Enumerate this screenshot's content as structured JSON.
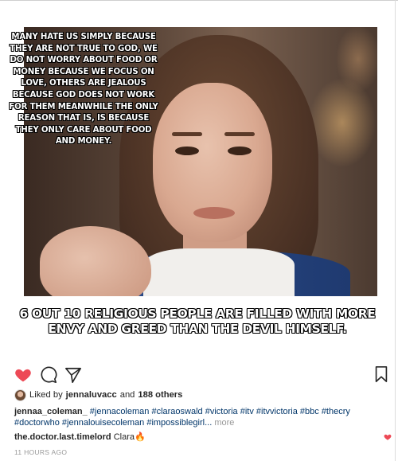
{
  "meme": {
    "top_text": "MANY HATE US SIMPLY BECAUSE THEY ARE NOT TRUE TO GOD, WE DO NOT WORRY ABOUT FOOD OR MONEY BECAUSE WE FOCUS ON LOVE, OTHERS ARE JEALOUS BECAUSE GOD DOES NOT WORK FOR THEM MEANWHILE THE ONLY REASON THAT IS, IS BECAUSE THEY ONLY CARE ABOUT FOOD AND MONEY.",
    "bottom_text": "6 OUT 10 RELIGIOUS PEOPLE ARE FILLED WITH MORE ENVY AND GREED THAN THE DEVIL HIMSELF."
  },
  "actions": {
    "like_icon": "heart-icon",
    "comment_icon": "comment-icon",
    "share_icon": "paper-plane-icon",
    "save_icon": "bookmark-icon",
    "like_color": "#ed4956"
  },
  "likes": {
    "prefix": "Liked by",
    "user": "jennaluvacc",
    "joiner": "and",
    "others": "188 others"
  },
  "caption": {
    "user": "jennaa_coleman_",
    "tags": "#jennacoleman #claraoswald #victoria #itv #itvvictoria #bbc #thecry #doctorwho #jennalouisecoleman #impossiblegirl...",
    "more": "more"
  },
  "comment": {
    "user": "the.doctor.last.timelord",
    "text": "Clara🔥"
  },
  "timestamp": "11 HOURS AGO"
}
